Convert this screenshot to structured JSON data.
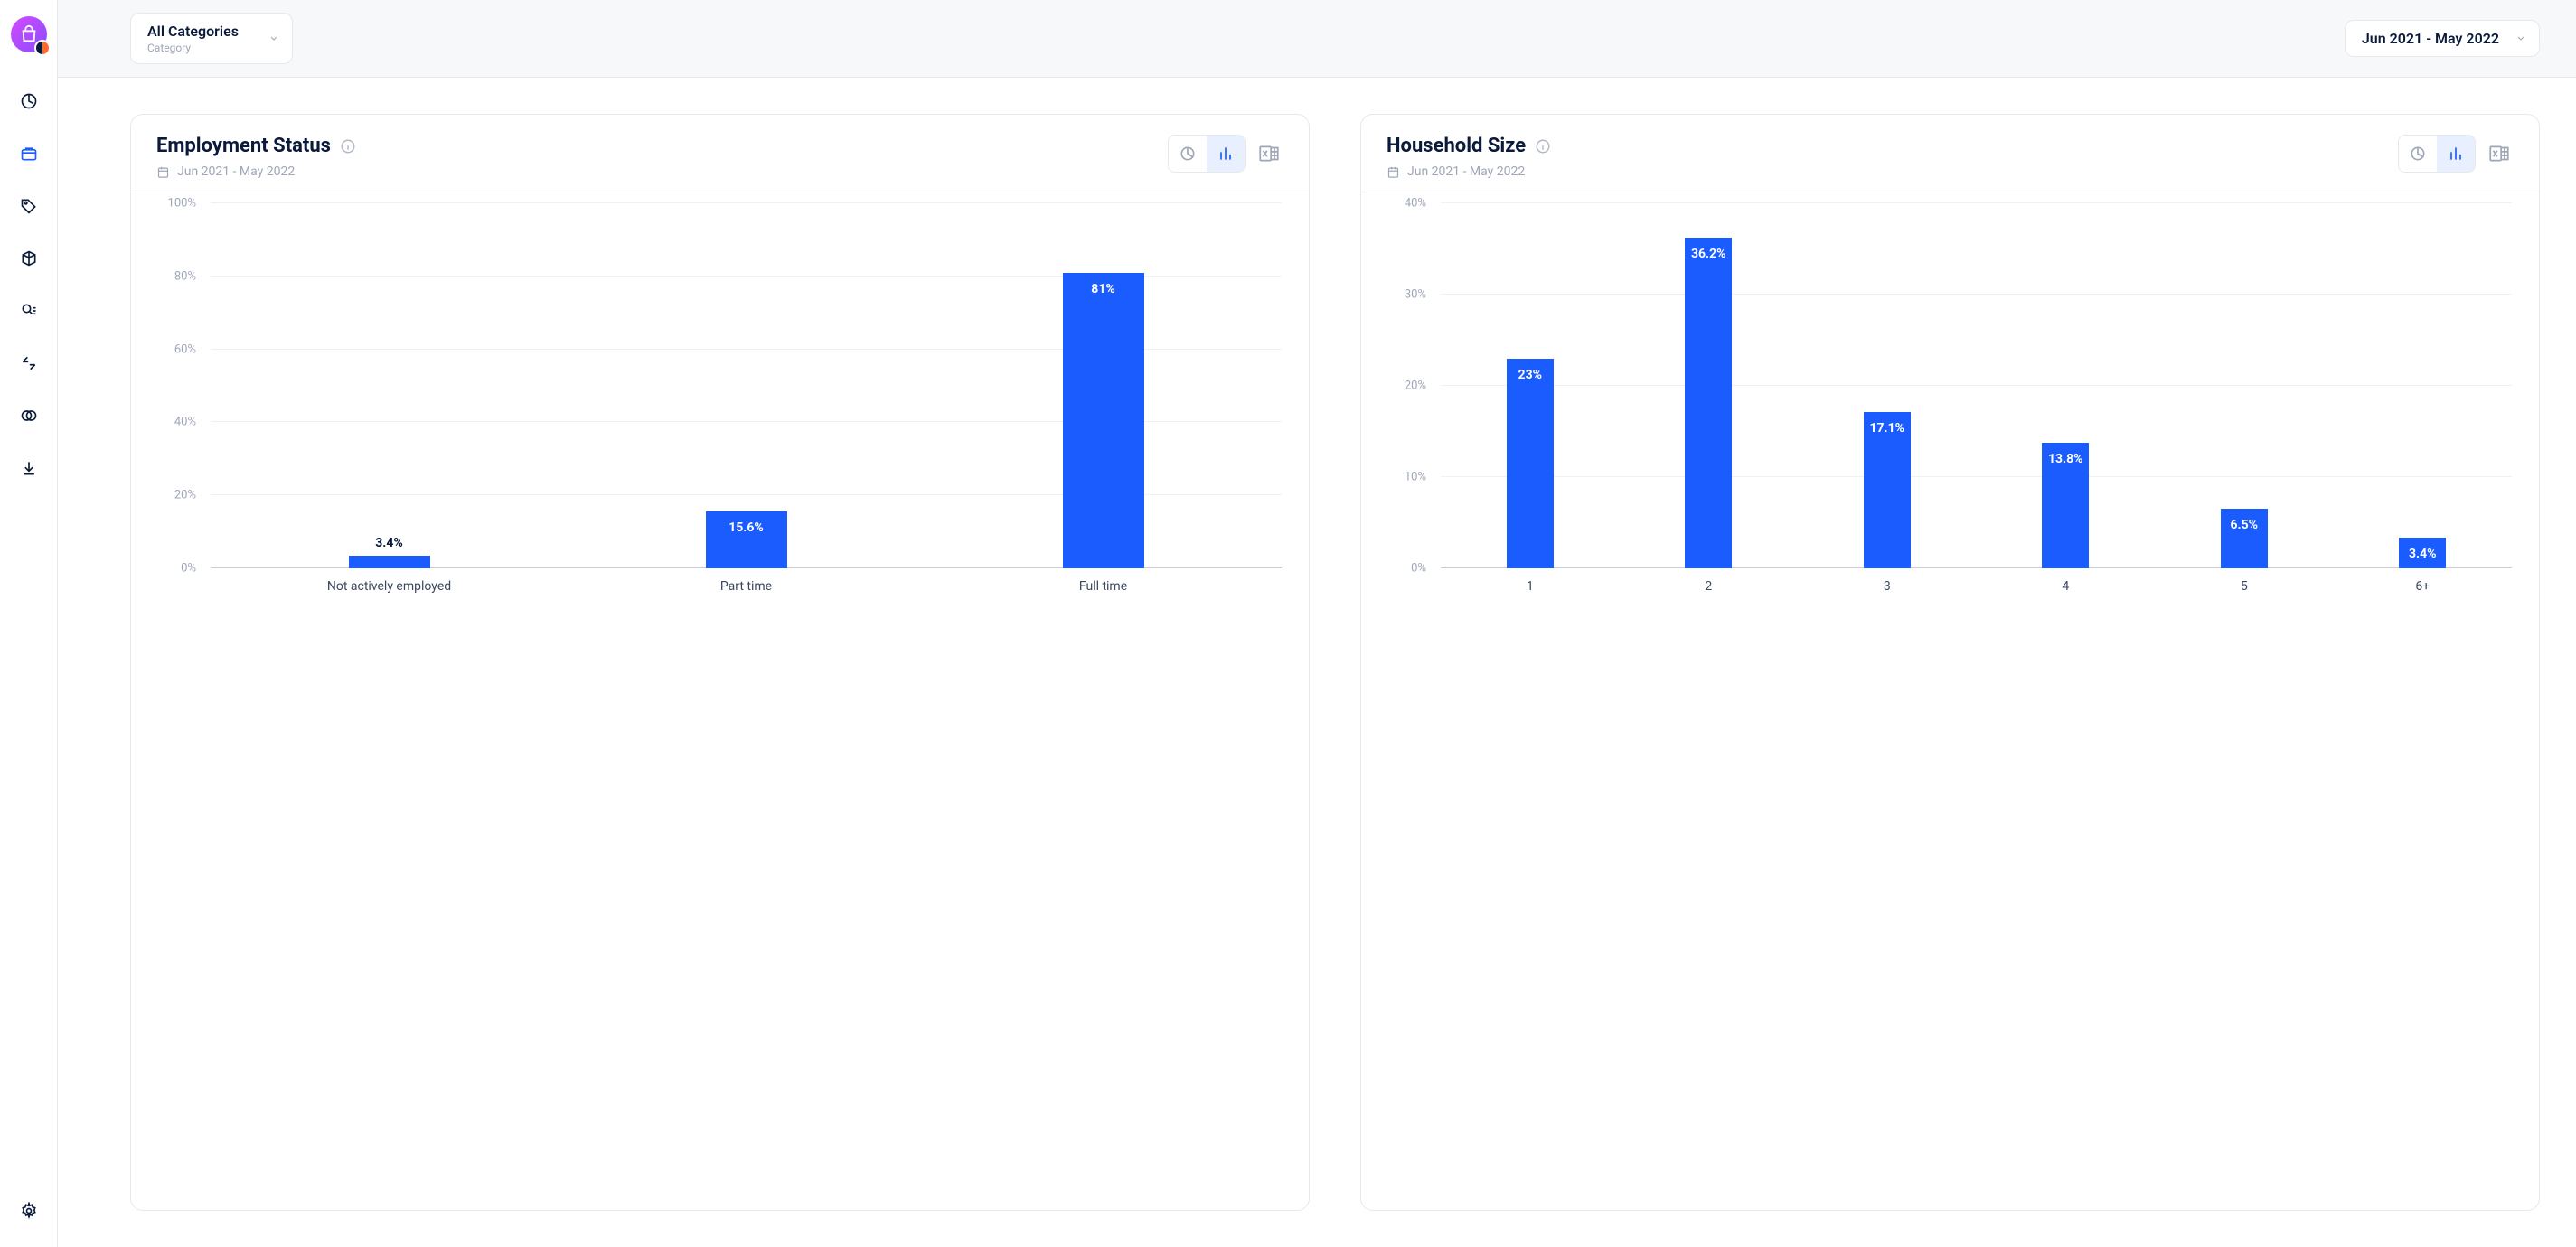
{
  "topbar": {
    "category_dropdown": {
      "value": "All Categories",
      "caption": "Category"
    },
    "date_dropdown": {
      "value": "Jun 2021 - May 2022"
    }
  },
  "cards": [
    {
      "title": "Employment Status",
      "date_range": "Jun 2021 - May 2022"
    },
    {
      "title": "Household Size",
      "date_range": "Jun 2021 - May 2022"
    }
  ],
  "chart_data": [
    {
      "type": "bar",
      "title": "Employment Status",
      "categories": [
        "Not actively employed",
        "Part time",
        "Full time"
      ],
      "values": [
        3.4,
        15.6,
        81
      ],
      "value_labels": [
        "3.4%",
        "15.6%",
        "81%"
      ],
      "ylabel": "",
      "ylim": [
        0,
        100
      ],
      "yticks": [
        0,
        20,
        40,
        60,
        80,
        100
      ],
      "ytick_labels": [
        "0%",
        "20%",
        "40%",
        "60%",
        "80%",
        "100%"
      ],
      "bar_color": "#1b5cff"
    },
    {
      "type": "bar",
      "title": "Household Size",
      "categories": [
        "1",
        "2",
        "3",
        "4",
        "5",
        "6+"
      ],
      "values": [
        23,
        36.2,
        17.1,
        13.8,
        6.5,
        3.4
      ],
      "value_labels": [
        "23%",
        "36.2%",
        "17.1%",
        "13.8%",
        "6.5%",
        "3.4%"
      ],
      "ylabel": "",
      "ylim": [
        0,
        40
      ],
      "yticks": [
        0,
        10,
        20,
        30,
        40
      ],
      "ytick_labels": [
        "0%",
        "10%",
        "20%",
        "30%",
        "40%"
      ],
      "bar_color": "#1b5cff"
    }
  ]
}
